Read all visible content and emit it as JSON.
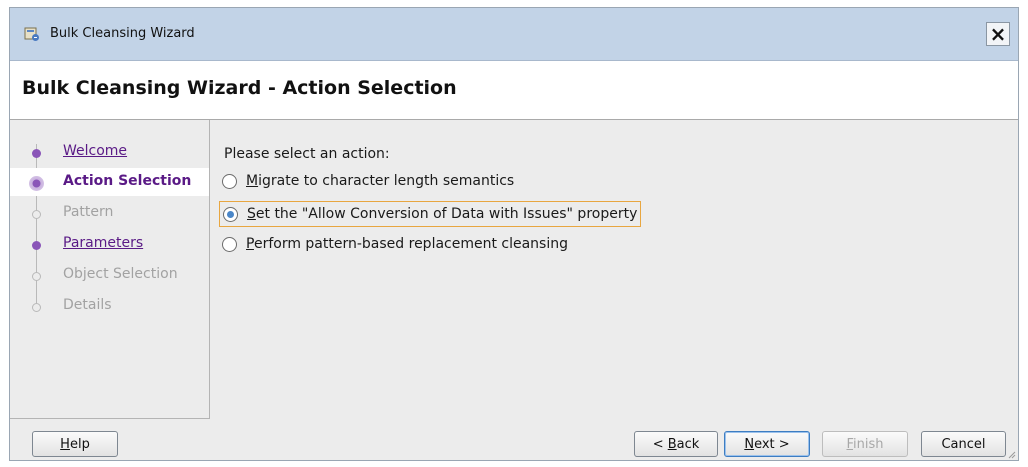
{
  "window": {
    "title": "Bulk Cleansing Wizard",
    "icon": "wizard-app-icon",
    "close_label": "×"
  },
  "header": {
    "title": "Bulk Cleansing Wizard - Action Selection"
  },
  "nav": {
    "items": [
      {
        "label": "Welcome",
        "state": "link"
      },
      {
        "label": "Action Selection",
        "state": "active"
      },
      {
        "label": "Pattern",
        "state": "disabled"
      },
      {
        "label": "Parameters",
        "state": "link"
      },
      {
        "label": "Object Selection",
        "state": "disabled"
      },
      {
        "label": "Details",
        "state": "disabled"
      }
    ]
  },
  "main": {
    "prompt": "Please select an action:",
    "options": [
      {
        "label": "Migrate to character length semantics",
        "mnemonic": "M",
        "rest": "igrate to character length semantics",
        "checked": false
      },
      {
        "label": "Set the \"Allow Conversion of Data with Issues\" property",
        "mnemonic": "S",
        "rest": "et the \"Allow Conversion of Data with Issues\" property",
        "checked": true
      },
      {
        "label": "Perform pattern-based replacement cleansing",
        "mnemonic": "P",
        "rest": "erform pattern-based replacement cleansing",
        "checked": false
      }
    ]
  },
  "footer": {
    "help": {
      "mnemonic": "H",
      "rest": "elp"
    },
    "back": {
      "prefix": "< ",
      "mnemonic": "B",
      "rest": "ack"
    },
    "next": {
      "mnemonic": "N",
      "rest": "ext >"
    },
    "finish": {
      "mnemonic": "F",
      "rest": "inish"
    },
    "cancel": "Cancel"
  },
  "colors": {
    "title_bar": "#c2d3e7",
    "nav_link": "#5a1a86",
    "radio_selected": "#4a86c8",
    "focus_ring": "#e8a640"
  }
}
